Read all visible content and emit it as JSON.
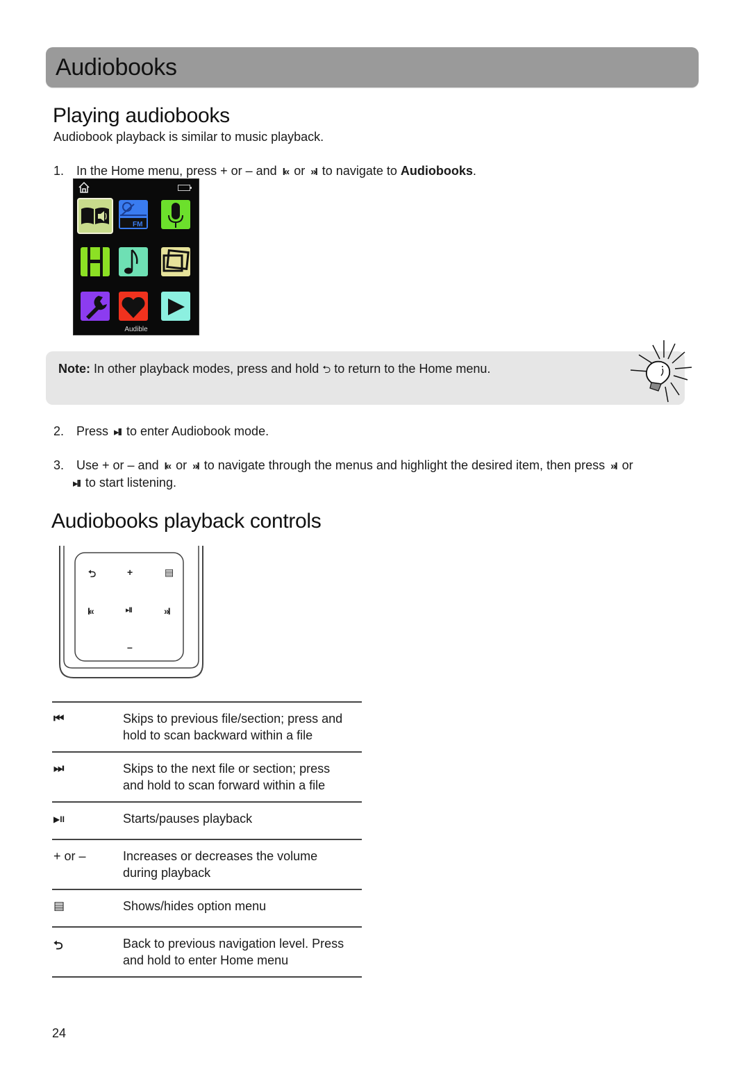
{
  "chapter": {
    "title": "Audiobooks"
  },
  "section1": {
    "title": "Playing audiobooks",
    "intro": "Audiobook playback is similar to music playback.",
    "step1": {
      "num": "1.",
      "pre": "In the Home menu, press + or – and",
      "prev_glyph": "I«",
      "or": "or",
      "next_glyph": "»I",
      "post": "to navigate to",
      "target": "Audiobooks",
      "end": "."
    },
    "screen": {
      "caption": "Audible",
      "tiles": [
        {
          "name": "audiobooks",
          "color": "#c8dc8c",
          "selected": true
        },
        {
          "name": "fm-radio",
          "color": "#3a7cf0",
          "label": "FM"
        },
        {
          "name": "recorder",
          "color": "#6ce02c"
        },
        {
          "name": "videos",
          "color": "#8ce024"
        },
        {
          "name": "music",
          "color": "#6ee0b4"
        },
        {
          "name": "photos",
          "color": "#e6e29a"
        },
        {
          "name": "settings",
          "color": "#8c3cf0"
        },
        {
          "name": "favorites",
          "color": "#f0321e"
        },
        {
          "name": "now-playing",
          "color": "#8cf0e0"
        }
      ]
    },
    "note": {
      "label": "Note:",
      "pre": "In other playback modes, press and hold",
      "glyph": "⮌",
      "post": "to return to the Home menu."
    },
    "step2": {
      "num": "2.",
      "pre": "Press",
      "glyph": "▸II",
      "post": "to enter Audiobook mode."
    },
    "step3": {
      "num": "3.",
      "pre": "Use  + or – and",
      "prev_glyph": "I«",
      "or1": "or",
      "next_glyph": "»I",
      "mid": "to navigate through the menus and highlight the desired item, then press",
      "next_glyph2": "»I",
      "or2": "or",
      "play_glyph": "▸II",
      "end": "to start listening."
    }
  },
  "section2": {
    "title": "Audiobooks playback controls",
    "device_buttons": {
      "back": "⮌",
      "plus": "+",
      "menu": "▤",
      "prev": "I«",
      "play": "▸II",
      "next": "»I",
      "minus": "–"
    },
    "rows": [
      {
        "key": "⏮",
        "desc": [
          "Skips to previous file/section; press and",
          "hold to scan backward within a file"
        ]
      },
      {
        "key": "⏭",
        "desc": [
          "Skips to the next file or section; press",
          "and hold to scan forward within a file"
        ]
      },
      {
        "key": "▶II",
        "desc": [
          "Starts/pauses playback"
        ]
      },
      {
        "key": "+ or –",
        "desc": [
          "Increases or decreases the volume",
          "during playback"
        ]
      },
      {
        "key": "▤",
        "desc": [
          "Shows/hides option menu"
        ]
      },
      {
        "key": "⮌",
        "desc": [
          "Back to previous navigation level. Press",
          "and hold to enter Home menu"
        ]
      }
    ]
  },
  "footer": {
    "page_number": "24"
  }
}
